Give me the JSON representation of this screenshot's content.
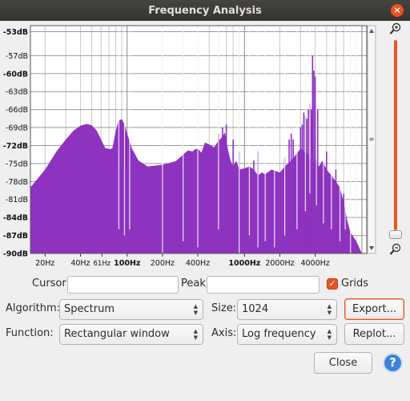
{
  "window": {
    "title": "Frequency Analysis"
  },
  "chart_data": {
    "type": "area",
    "xscale": "log",
    "xlim": [
      15,
      11000
    ],
    "ylim": [
      -90,
      -52
    ],
    "color": "#8d33bf",
    "y_ticks": [
      "-53dB",
      "-57dB",
      "-60dB",
      "-63dB",
      "-66dB",
      "-69dB",
      "-72dB",
      "-75dB",
      "-78dB",
      "-81dB",
      "-84dB",
      "-87dB",
      "-90dB"
    ],
    "y_tick_values": [
      -53,
      -57,
      -60,
      -63,
      -66,
      -69,
      -72,
      -75,
      -78,
      -81,
      -84,
      -87,
      -90
    ],
    "x_ticks": [
      {
        "v": 20,
        "label": "20Hz",
        "bold": false
      },
      {
        "v": 40,
        "label": "40Hz",
        "bold": false
      },
      {
        "v": 61,
        "label": "61Hz",
        "bold": false
      },
      {
        "v": 100,
        "label": "100Hz",
        "bold": true
      },
      {
        "v": 200,
        "label": "200Hz",
        "bold": false
      },
      {
        "v": 400,
        "label": "400Hz",
        "bold": false
      },
      {
        "v": 1000,
        "label": "1000Hz",
        "bold": true
      },
      {
        "v": 2000,
        "label": "2000Hz",
        "bold": false
      },
      {
        "v": 4000,
        "label": "4000Hz",
        "bold": false
      }
    ],
    "spectrum": {
      "x": [
        15,
        20,
        25,
        30,
        35,
        40,
        45,
        50,
        55,
        60,
        65,
        72,
        75,
        80,
        85,
        90,
        95,
        100,
        110,
        125,
        150,
        200,
        260,
        300,
        330,
        360,
        380,
        400,
        430,
        460,
        500,
        550,
        600,
        650,
        680,
        700,
        720,
        760,
        800,
        850,
        900,
        1000,
        1100,
        1200,
        1300,
        1400,
        1500,
        1700,
        2000,
        2200,
        2500,
        3000,
        3500,
        3800,
        4000,
        4300,
        4600,
        5000,
        5500,
        6000,
        6500,
        7000,
        7500,
        8000,
        9000,
        10000,
        11000
      ],
      "y": [
        -79,
        -76,
        -73,
        -71,
        -69.5,
        -68.7,
        -68.4,
        -68.6,
        -69.5,
        -71,
        -72.4,
        -72.6,
        -72.4,
        -69.5,
        -67.8,
        -67.6,
        -68.5,
        -70,
        -72.5,
        -74.5,
        -75.5,
        -75.2,
        -74.6,
        -73.5,
        -72.8,
        -73,
        -72.6,
        -72.5,
        -73.2,
        -71.5,
        -71.8,
        -72.3,
        -71.2,
        -70.5,
        -69.8,
        -71,
        -72.5,
        -74.5,
        -75.5,
        -74.5,
        -76,
        -75.8,
        -75.5,
        -76,
        -77,
        -76.5,
        -76.8,
        -76,
        -76.5,
        -75.5,
        -74.5,
        -72.5,
        -73.5,
        -75,
        -74,
        -75.5,
        -74.5,
        -76,
        -77,
        -78,
        -79,
        -81.5,
        -84.5,
        -86.5,
        -88,
        -90,
        -90
      ]
    },
    "peaks": [
      [
        71,
        -75
      ],
      [
        75,
        -75
      ],
      [
        80,
        -74
      ],
      [
        85,
        -76
      ],
      [
        90,
        -76
      ],
      [
        600,
        -70
      ],
      [
        650,
        -69
      ],
      [
        700,
        -68.5
      ],
      [
        800,
        -71
      ],
      [
        900,
        -73
      ],
      [
        1200,
        -74.5
      ],
      [
        1300,
        -73
      ],
      [
        2200,
        -74
      ],
      [
        2400,
        -71
      ],
      [
        2500,
        -70
      ],
      [
        2600,
        -71
      ],
      [
        3000,
        -69
      ],
      [
        3100,
        -68.5
      ],
      [
        3200,
        -66.5
      ],
      [
        3300,
        -67
      ],
      [
        3400,
        -67.5
      ],
      [
        3500,
        -66
      ],
      [
        3600,
        -65
      ],
      [
        3700,
        -66
      ],
      [
        3750,
        -67
      ],
      [
        3800,
        -57
      ],
      [
        3900,
        -59.5
      ],
      [
        4000,
        -60.5
      ],
      [
        4200,
        -66
      ],
      [
        5000,
        -73
      ],
      [
        6000,
        -76
      ],
      [
        7000,
        -80
      ]
    ],
    "dips": [
      [
        85,
        -86
      ],
      [
        95,
        -87
      ],
      [
        105,
        -86
      ],
      [
        200,
        -90
      ],
      [
        300,
        -88
      ],
      [
        400,
        -89
      ],
      [
        600,
        -86
      ],
      [
        900,
        -90
      ],
      [
        1100,
        -87
      ],
      [
        1300,
        -89
      ],
      [
        1500,
        -88
      ],
      [
        1800,
        -89
      ],
      [
        2200,
        -87
      ],
      [
        2800,
        -86
      ],
      [
        3300,
        -83
      ],
      [
        3600,
        -80
      ],
      [
        4100,
        -82
      ],
      [
        4700,
        -85
      ],
      [
        5500,
        -86
      ],
      [
        6500,
        -88
      ],
      [
        7200,
        -86
      ],
      [
        8000,
        -90
      ],
      [
        9000,
        -87
      ]
    ]
  },
  "controls": {
    "cursor_label": "Cursor:",
    "cursor_value": "",
    "peak_label": "Peak:",
    "peak_value": "",
    "grids_label": "Grids",
    "grids_checked": true,
    "algorithm_label": "Algorithm:",
    "algorithm_value": "Spectrum",
    "size_label": "Size:",
    "size_value": "1024",
    "function_label": "Function:",
    "function_value": "Rectangular window",
    "axis_label": "Axis:",
    "axis_value": "Log frequency",
    "export_label": "Export...",
    "replot_label": "Replot...",
    "close_label": "Close",
    "help_label": "?"
  },
  "icons": {
    "zoom_in": "zoom-in-icon",
    "zoom_out": "zoom-out-icon",
    "help": "help-icon",
    "close": "close-window-icon"
  },
  "colors": {
    "accent": "#e95420",
    "spectrum": "#8d33bf",
    "help": "#3d83d8"
  }
}
